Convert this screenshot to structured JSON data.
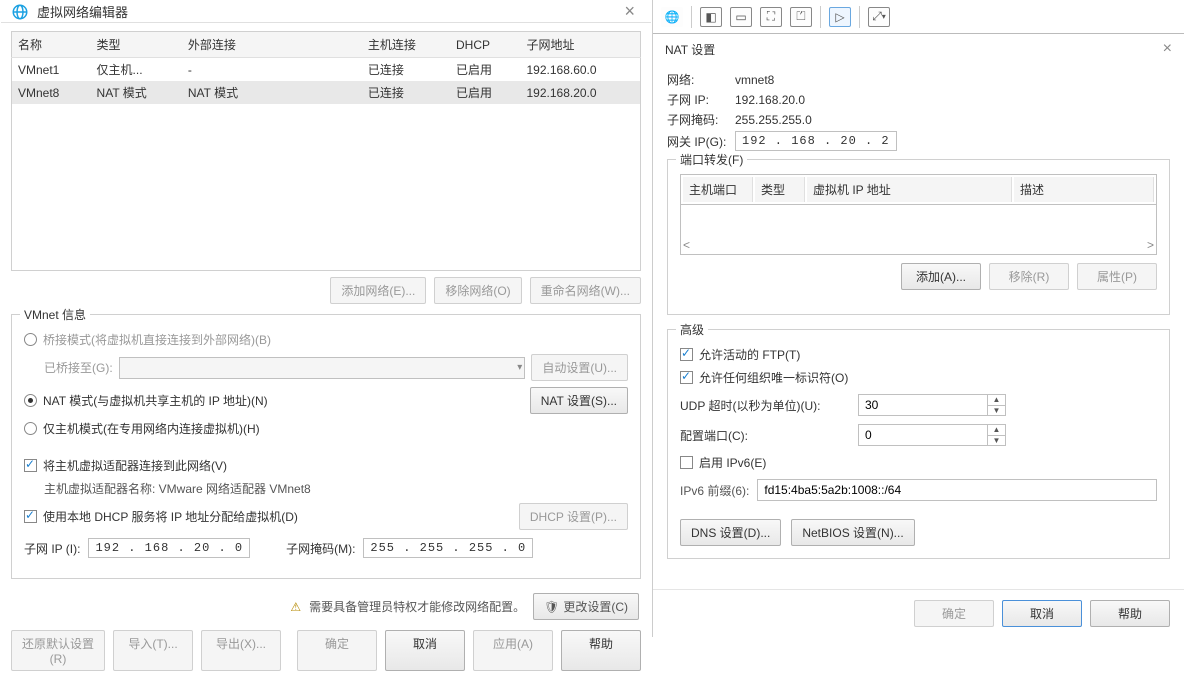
{
  "left": {
    "title": "虚拟网络编辑器",
    "columns": {
      "name": "名称",
      "type": "类型",
      "ext": "外部连接",
      "host": "主机连接",
      "dhcp": "DHCP",
      "subnet": "子网地址"
    },
    "rows": [
      {
        "name": "VMnet1",
        "type": "仅主机...",
        "ext": "-",
        "host": "已连接",
        "dhcp": "已启用",
        "subnet": "192.168.60.0"
      },
      {
        "name": "VMnet8",
        "type": "NAT 模式",
        "ext": "NAT 模式",
        "host": "已连接",
        "dhcp": "已启用",
        "subnet": "192.168.20.0"
      }
    ],
    "net_btns": {
      "add": "添加网络(E)...",
      "remove": "移除网络(O)",
      "rename": "重命名网络(W)..."
    },
    "info_title": "VMnet 信息",
    "bridge": "桥接模式(将虚拟机直接连接到外部网络)(B)",
    "bridge_to": "已桥接至(G):",
    "auto": "自动设置(U)...",
    "nat": "NAT 模式(与虚拟机共享主机的 IP 地址)(N)",
    "nat_btn": "NAT 设置(S)...",
    "hostonly": "仅主机模式(在专用网络内连接虚拟机)(H)",
    "host_adapter": "将主机虚拟适配器连接到此网络(V)",
    "host_adapter_name_lbl": "主机虚拟适配器名称: ",
    "host_adapter_name": "VMware 网络适配器 VMnet8",
    "use_dhcp": "使用本地 DHCP 服务将 IP 地址分配给虚拟机(D)",
    "dhcp_btn": "DHCP 设置(P)...",
    "subnet_ip_lbl": "子网 IP (I):",
    "subnet_ip": "192 . 168 . 20 .  0",
    "subnet_mask_lbl": "子网掩码(M):",
    "subnet_mask": "255 . 255 . 255 .  0",
    "warn": "需要具备管理员特权才能修改网络配置。",
    "change": "更改设置(C)",
    "bottom": {
      "restore": "还原默认设置(R)",
      "import": "导入(T)...",
      "export": "导出(X)...",
      "ok": "确定",
      "cancel": "取消",
      "apply": "应用(A)",
      "help": "帮助"
    }
  },
  "right": {
    "title": "NAT 设置",
    "net_lbl": "网络:",
    "net": "vmnet8",
    "subnet_lbl": "子网 IP:",
    "subnet": "192.168.20.0",
    "mask_lbl": "子网掩码:",
    "mask": "255.255.255.0",
    "gw_lbl": "网关 IP(G):",
    "gw": "192 . 168 . 20 .  2",
    "port_fwd": "端口转发(F)",
    "pf_cols": {
      "hp": "主机端口",
      "type": "类型",
      "vip": "虚拟机 IP 地址",
      "desc": "描述"
    },
    "pf_btns": {
      "add": "添加(A)...",
      "remove": "移除(R)",
      "prop": "属性(P)"
    },
    "adv": "高级",
    "ftp": "允许活动的 FTP(T)",
    "oui": "允许任何组织唯一标识符(O)",
    "udp_lbl": "UDP 超时(以秒为单位)(U):",
    "udp": "30",
    "cfg_port_lbl": "配置端口(C):",
    "cfg_port": "0",
    "ipv6": "启用 IPv6(E)",
    "ipv6_prefix_lbl": "IPv6 前缀(6):",
    "ipv6_prefix": "fd15:4ba5:5a2b:1008::/64",
    "dns": "DNS 设置(D)...",
    "netbios": "NetBIOS 设置(N)...",
    "ok": "确定",
    "cancel": "取消",
    "help": "帮助"
  }
}
